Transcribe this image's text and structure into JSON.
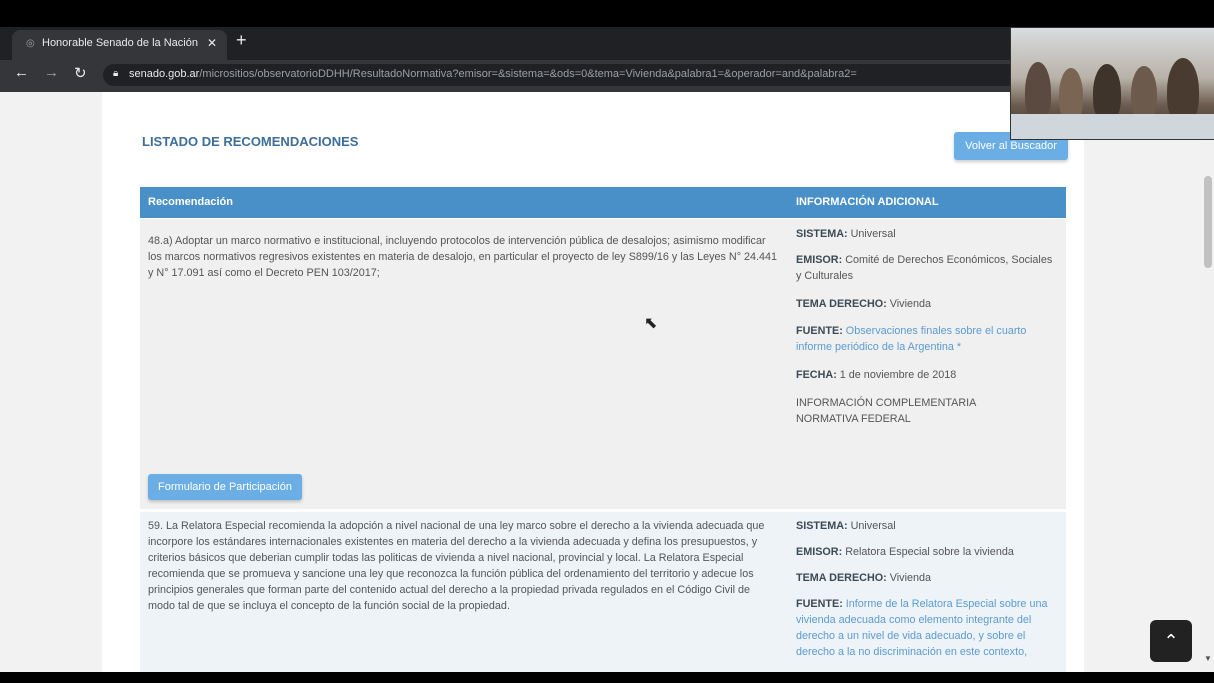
{
  "browser": {
    "tab_title": "Honorable Senado de la Nación",
    "tab_close": "✕",
    "new_tab": "+",
    "url_domain": "senado.gob.ar",
    "url_path": "/micrositios/observatorioDDHH/ResultadoNormativa?emisor=&sistema=&ods=0&tema=Vivienda&palabra1=&operador=and&palabra2="
  },
  "page": {
    "heading": "LISTADO DE RECOMENDACIONES",
    "back_button": "Volver al Buscador",
    "table": {
      "col_recommendation": "Recomendación",
      "col_info": "INFORMACIÓN ADICIONAL"
    },
    "rows": [
      {
        "text": "48.a) Adoptar un marco normativo e institucional, incluyendo protocolos de intervención pública de desalojos; asimismo modificar los marcos normativos regresivos existentes en materia de desalojo, en particular el proyecto de ley S899/16 y las Leyes N° 24.441 y N° 17.091 así como el Decreto PEN 103/2017;",
        "sistema_label": "SISTEMA:",
        "sistema": "Universal",
        "emisor_label": "EMISOR:",
        "emisor": "Comité de Derechos Económicos, Sociales y Culturales",
        "tema_label": "TEMA DERECHO:",
        "tema": "Vivienda",
        "fuente_label": "FUENTE:",
        "fuente": "Observaciones finales sobre el cuarto informe periódico de la Argentina *",
        "fecha_label": "FECHA:",
        "fecha": "1 de noviembre de 2018",
        "complementaria": "INFORMACIÓN COMPLEMENTARIA",
        "normativa": "NORMATIVA FEDERAL",
        "form_button": "Formulario de Participación"
      },
      {
        "text": "59. La Relatora Especial recomienda la adopción a nivel nacional de una ley marco sobre el derecho a la vivienda adecuada que incorpore los estándares internacionales existentes en materia del derecho a la vivienda adecuada y defina los presupuestos, y criterios básicos que deberian cumplir todas las politicas de vivienda a nivel nacional, provincial y local. La Relatora Especial recomienda que se promueva y sancione una ley que reconozca la función pública del ordenamiento del territorio y adecue los principios generales que forman parte del contenido actual del derecho a la propiedad privada regulados en el Código Civil de modo tal de que se incluya el concepto de la función social de la propiedad.",
        "sistema_label": "SISTEMA:",
        "sistema": "Universal",
        "emisor_label": "EMISOR:",
        "emisor": "Relatora Especial sobre la vivienda",
        "tema_label": "TEMA DERECHO:",
        "tema": "Vivienda",
        "fuente_label": "FUENTE:",
        "fuente": "Informe de la Relatora Especial sobre una vivienda adecuada como elemento integrante del derecho a un nivel de vida adecuado, y sobre el derecho a la no discriminación en este contexto,"
      }
    ]
  }
}
